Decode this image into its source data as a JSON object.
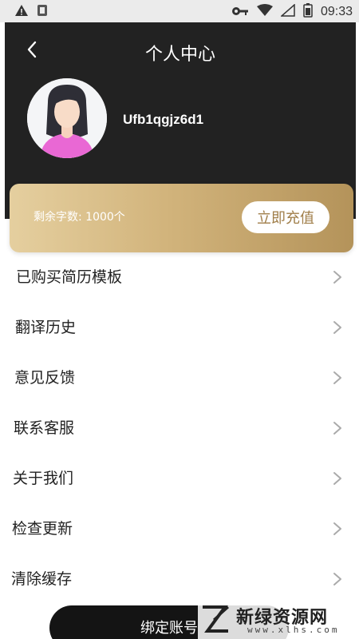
{
  "status_bar": {
    "time": "09:33",
    "icons": [
      "warning-icon",
      "notification-icon",
      "key-icon",
      "wifi-icon",
      "signal-icon",
      "battery-icon"
    ]
  },
  "header": {
    "title": "个人中心",
    "username": "Ufb1qgjz6d1",
    "background_color": "#222222"
  },
  "balance": {
    "text": "剩余字数: 1000个",
    "button_label": "立即充值",
    "accent_color": "#b4935a"
  },
  "menu": {
    "items": [
      {
        "label": "已购买简历模板"
      },
      {
        "label": "翻译历史"
      },
      {
        "label": "意见反馈"
      },
      {
        "label": "联系客服"
      },
      {
        "label": "关于我们"
      },
      {
        "label": "检查更新"
      },
      {
        "label": "清除缓存"
      }
    ]
  },
  "footer": {
    "bind_button_label": "绑定账号"
  },
  "watermark": {
    "title": "新绿资源网",
    "subtitle": "www.xlhs.com"
  }
}
